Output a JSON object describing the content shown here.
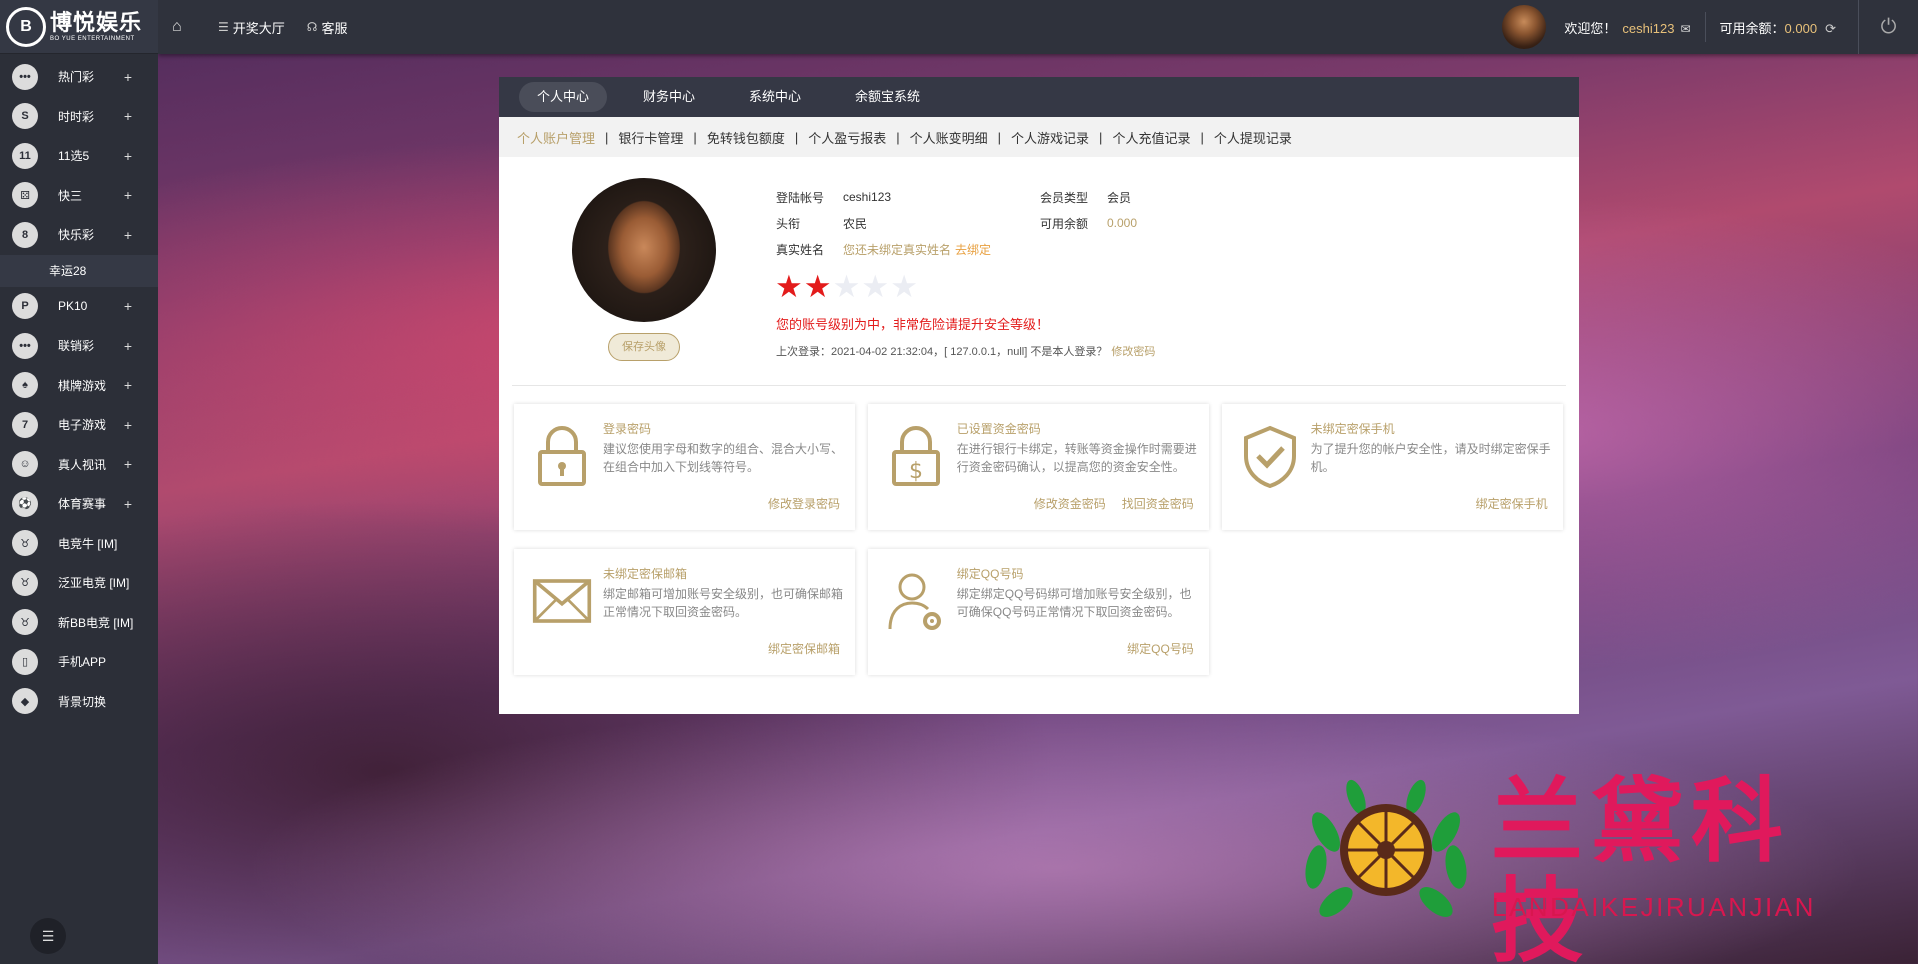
{
  "logo": {
    "cn": "博悦娱乐",
    "en": "BO YUE ENTERTAINMENT"
  },
  "sidebar": {
    "items": [
      {
        "label": "热门彩",
        "icon": "dots-icon",
        "plus": "+"
      },
      {
        "label": "时时彩",
        "icon": "ssc-icon",
        "plus": "+"
      },
      {
        "label": "11选5",
        "icon": "11x5-icon",
        "plus": "+"
      },
      {
        "label": "快三",
        "icon": "dice-icon",
        "plus": "+"
      },
      {
        "label": "快乐彩",
        "icon": "happy-lottery-icon",
        "plus": "+"
      },
      {
        "label": "PK10",
        "icon": "pk10-icon",
        "plus": "+"
      },
      {
        "label": "联销彩",
        "icon": "dots-icon",
        "plus": "+"
      },
      {
        "label": "棋牌游戏",
        "icon": "cards-icon",
        "plus": "+"
      },
      {
        "label": "电子游戏",
        "icon": "slot-icon",
        "plus": "+"
      },
      {
        "label": "真人视讯",
        "icon": "dealer-icon",
        "plus": "+"
      },
      {
        "label": "体育赛事",
        "icon": "sports-icon",
        "plus": "+"
      },
      {
        "label": "电竞牛 [IM]",
        "icon": "bull-icon",
        "plus": ""
      },
      {
        "label": "泛亚电竞 [IM]",
        "icon": "bull-icon",
        "plus": ""
      },
      {
        "label": "新BB电竞 [IM]",
        "icon": "bull-icon",
        "plus": ""
      },
      {
        "label": "手机APP",
        "icon": "phone-icon",
        "plus": ""
      },
      {
        "label": "背景切换",
        "icon": "diamond-icon",
        "plus": ""
      }
    ],
    "sub_item": "幸运28"
  },
  "topbar": {
    "lottery_hall": "开奖大厅",
    "service": "客服",
    "welcome": "欢迎您！",
    "username": "ceshi123",
    "balance_label": "可用余额：",
    "balance_value": "0.000"
  },
  "tabs": [
    "个人中心",
    "财务中心",
    "系统中心",
    "余额宝系统"
  ],
  "subnav": [
    "个人账户管理",
    "银行卡管理",
    "免转钱包额度",
    "个人盈亏报表",
    "个人账变明细",
    "个人游戏记录",
    "个人充值记录",
    "个人提现记录"
  ],
  "profile": {
    "save_avatar": "保存头像",
    "account_label": "登陆帐号",
    "account_value": "ceshi123",
    "title_label": "头衔",
    "title_value": "农民",
    "realname_label": "真实姓名",
    "realname_value": "您还未绑定真实姓名",
    "bind_link": "去绑定",
    "member_type_label": "会员类型",
    "member_type_value": "会员",
    "balance_label": "可用余额",
    "balance_value": "0.000",
    "security_stars": 2,
    "security_stars_total": 5,
    "warning": "您的账号级别为中，非常危险请提升安全等级！",
    "last_login": "上次登录：2021-04-02 21:32:04，[ 127.0.0.1，null] 不是本人登录？",
    "change_password": "修改密码"
  },
  "cards": [
    {
      "title": "登录密码",
      "icon": "lock-icon",
      "desc": "建议您使用字母和数字的组合、混合大小写、在组合中加入下划线等符号。",
      "links": [
        "修改登录密码"
      ]
    },
    {
      "title": "已设置资金密码",
      "icon": "money-lock-icon",
      "desc": "在进行银行卡绑定，转账等资金操作时需要进行资金密码确认，以提高您的资金安全性。",
      "links": [
        "修改资金密码",
        "找回资金密码"
      ]
    },
    {
      "title": "未绑定密保手机",
      "icon": "shield-check-icon",
      "desc": "为了提升您的帐户安全性，请及时绑定密保手机。",
      "links": [
        "绑定密保手机"
      ]
    },
    {
      "title": "未绑定密保邮箱",
      "icon": "envelope-icon",
      "desc": "绑定邮箱可增加账号安全级别，也可确保邮箱正常情况下取回资金密码。",
      "links": [
        "绑定密保邮箱"
      ]
    },
    {
      "title": "绑定QQ号码",
      "icon": "user-gear-icon",
      "desc": "绑定绑定QQ号码绑可增加账号安全级别，也可确保QQ号码正常情况下取回资金密码。",
      "links": [
        "绑定QQ号码"
      ]
    }
  ],
  "watermark": {
    "cn": "兰黛科技",
    "en": "LANDAIKEJIRUANJIAN"
  }
}
